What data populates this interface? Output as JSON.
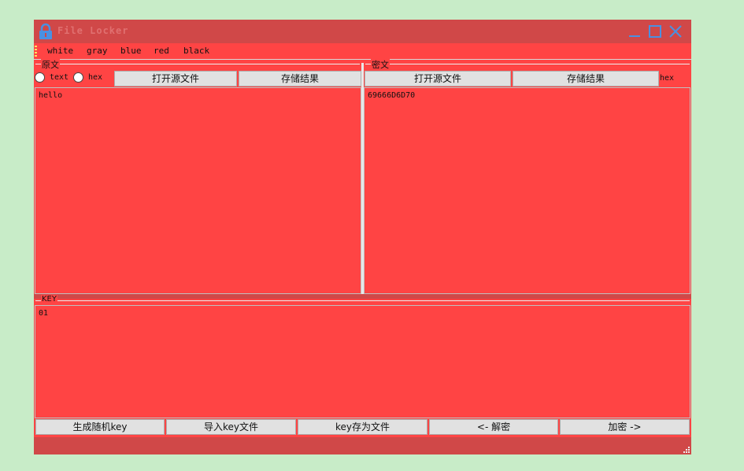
{
  "window": {
    "title": "File Locker",
    "controls": {
      "minimize": "minimize-icon",
      "maximize": "maximize-icon",
      "close": "close-icon"
    }
  },
  "menu": [
    "white",
    "gray",
    "blue",
    "red",
    "black"
  ],
  "source": {
    "group_label": "原文",
    "radio_text": "text",
    "radio_hex": "hex",
    "open_button": "打开源文件",
    "save_button": "存储结果",
    "content": "hello"
  },
  "cipher": {
    "group_label": "密文",
    "open_button": "打开源文件",
    "save_button": "存储结果",
    "mode_label": "hex",
    "content": "69666D6D70"
  },
  "key": {
    "group_label": "KEY",
    "content": "01"
  },
  "actions": {
    "generate": "生成随机key",
    "import": "导入key文件",
    "save_key": "key存为文件",
    "decrypt": "<- 解密",
    "encrypt": "加密 ->"
  },
  "colors": {
    "titlebar": "#d04848",
    "body": "#ff4444",
    "accent": "#4a90e2",
    "background": "#c8ecc8"
  }
}
